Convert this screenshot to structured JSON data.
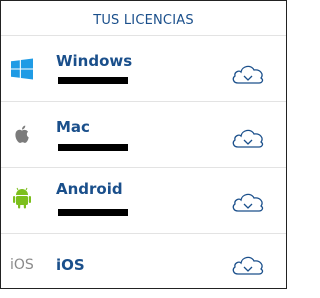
{
  "header": {
    "title": "TUS LICENCIAS"
  },
  "platforms": [
    {
      "name": "Windows",
      "icon": "windows-icon"
    },
    {
      "name": "Mac",
      "icon": "apple-icon"
    },
    {
      "name": "Android",
      "icon": "android-icon"
    },
    {
      "name": "iOS",
      "icon": "ios-icon",
      "icon_text": "iOS"
    }
  ],
  "colors": {
    "title": "#1a4f8b",
    "windows": "#1f9be5",
    "apple": "#7b7b7b",
    "android": "#7cbf1d",
    "cloud": "#1a4f8b"
  }
}
